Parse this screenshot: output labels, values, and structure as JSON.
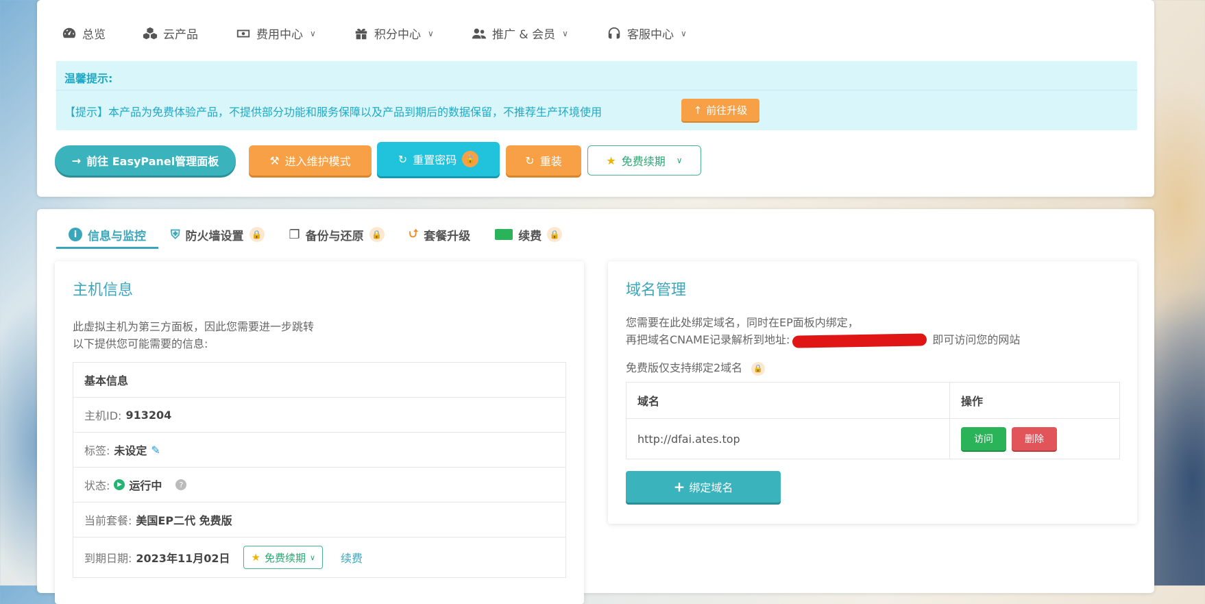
{
  "nav": {
    "items": [
      {
        "label": "总览",
        "icon": "dashboard-icon",
        "has_chevron": false
      },
      {
        "label": "云产品",
        "icon": "cubes-icon",
        "has_chevron": false
      },
      {
        "label": "费用中心",
        "icon": "money-icon",
        "has_chevron": true
      },
      {
        "label": "积分中心",
        "icon": "gift-icon",
        "has_chevron": true
      },
      {
        "label": "推广 & 会员",
        "icon": "users-icon",
        "has_chevron": true
      },
      {
        "label": "客服中心",
        "icon": "headset-icon",
        "has_chevron": true
      }
    ]
  },
  "notice": {
    "title": "温馨提示:",
    "text": "【提示】本产品为免费体验产品，不提供部分功能和服务保障以及产品到期后的数据保留，不推荐生产环境使用",
    "upgrade_label": "前往升级"
  },
  "actions": {
    "panel": "前往 EasyPanel管理面板",
    "maintenance": "进入维护模式",
    "reset_password": "重置密码",
    "reinstall": "重装",
    "free_renew": "免费续期"
  },
  "tabs": [
    {
      "label": "信息与监控",
      "active": true,
      "locked": false
    },
    {
      "label": "防火墙设置",
      "active": false,
      "locked": true
    },
    {
      "label": "备份与还原",
      "active": false,
      "locked": true
    },
    {
      "label": "套餐升级",
      "active": false,
      "locked": false
    },
    {
      "label": "续费",
      "active": false,
      "locked": true
    }
  ],
  "host": {
    "title": "主机信息",
    "desc1": "此虚拟主机为第三方面板，因此您需要进一步跳转",
    "desc2": "以下提供您可能需要的信息:",
    "basic_head": "基本信息",
    "id_label": "主机ID:",
    "id_value": "913204",
    "tag_label": "标签:",
    "tag_value": "未设定",
    "status_label": "状态:",
    "status_value": "运行中",
    "plan_label": "当前套餐:",
    "plan_value": "美国EP二代 免费版",
    "expire_label": "到期日期:",
    "expire_value": "2023年11月02日",
    "renew_free": "免费续期",
    "renew_link": "续费"
  },
  "domain": {
    "title": "域名管理",
    "desc1": "您需要在此处绑定域名，同时在EP面板内绑定，",
    "desc2_a": "再把域名CNAME记录解析到地址:",
    "desc2_b": "即可访问您的网站",
    "limit": "免费版仅支持绑定2域名",
    "col_domain": "域名",
    "col_action": "操作",
    "rows": [
      {
        "domain": "http://dfai.ates.top"
      }
    ],
    "visit": "访问",
    "delete": "删除",
    "bind": "绑定域名"
  },
  "colors": {
    "accent": "#3aa6bb",
    "orange": "#f7a045",
    "cyan": "#21c2dc",
    "green": "#2bb35a",
    "red": "#e0545a"
  }
}
